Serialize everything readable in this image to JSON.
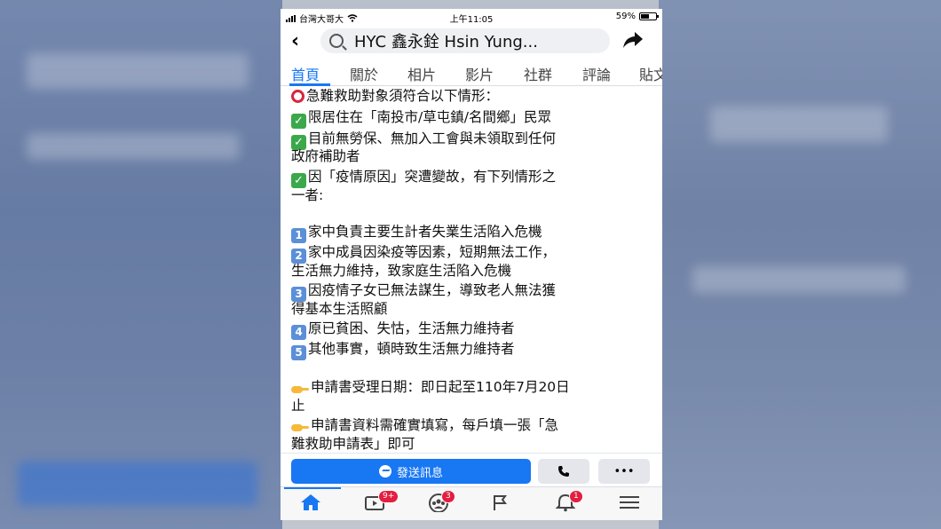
{
  "status_bar": {
    "carrier": "台灣大哥大",
    "time": "上午11:05",
    "battery": "59%",
    "battery_level": 0.59
  },
  "header": {
    "page_name": "HYC 鑫永銓 Hsin Yung..."
  },
  "tabs": [
    {
      "label": "首頁",
      "active": true
    },
    {
      "label": "關於"
    },
    {
      "label": "相片"
    },
    {
      "label": "影片"
    },
    {
      "label": "社群"
    },
    {
      "label": "評論"
    },
    {
      "label": "貼文"
    }
  ],
  "post": {
    "lines": [
      "急難救助對象須符合以下情形：",
      "限居住在「南投市/草屯鎮/名間鄉」民眾",
      "目前無勞保、無加入工會與未領取到任何",
      "政府補助者",
      "因「疫情原因」突遭變故，有下列情形之",
      "一者:",
      "家中負責主要生計者失業生活陷入危機",
      "家中成員因染疫等因素，短期無法工作，",
      "生活無力維持，致家庭生活陷入危機",
      "因疫情子女已無法謀生，導致老人無法獲",
      "得基本生活照顧",
      "原已貧困、失怙，生活無力維持者",
      "其他事實，頓時致生活無力維持者",
      "申請書受理日期：即日起至110年7月20日",
      "止",
      "申請書資料需確實填寫，每戶填一張「急",
      "難救助申請表」即可"
    ],
    "keycaps": [
      "1",
      "2",
      "3",
      "4",
      "5"
    ],
    "check_mark": "✓"
  },
  "actions": {
    "send_message": "發送訊息",
    "call_icon": "phone-icon",
    "more": "•••"
  },
  "bottom_nav": {
    "video_badge": "9+",
    "groups_badge": "3",
    "notifications_badge": "1"
  },
  "colors": {
    "accent": "#1877f2",
    "badge": "#e41e3f",
    "check": "#3ba84a",
    "red_circle": "#d7263d"
  }
}
